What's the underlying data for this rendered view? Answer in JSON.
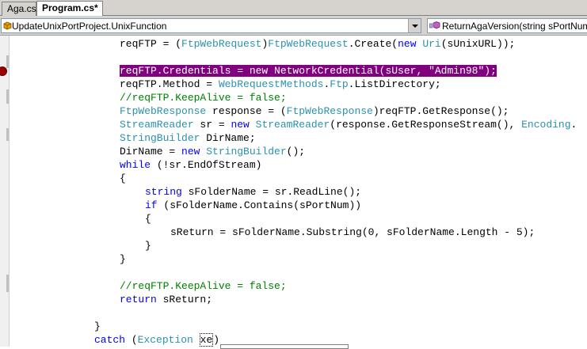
{
  "tabs": [
    "Aga.cs",
    "Program.cs*"
  ],
  "nav": {
    "class_combo": "UpdateUnixPortProject.UnixFunction",
    "member_combo": "ReturnAgaVersion(string sPortNum, st"
  },
  "code": {
    "l1": [
      "reqFTP",
      " = (",
      "FtpWebRequest",
      ")",
      "FtpWebRequest",
      ".Create(",
      "new",
      " ",
      "Uri",
      "(sUnixURL));"
    ],
    "l2": "reqFTP.Credentials = new NetworkCredential(sUser, \"Admin98\");",
    "l3": [
      "reqFTP.Method = ",
      "WebRequestMethods",
      ".",
      "Ftp",
      ".ListDirectory;"
    ],
    "l4": "//reqFTP.KeepAlive = false;",
    "l5": [
      "FtpWebResponse",
      " response = (",
      "FtpWebResponse",
      ")reqFTP.GetResponse();"
    ],
    "l6": [
      "StreamReader",
      " sr = ",
      "new",
      " ",
      "StreamReader",
      "(response.GetResponseStream(), ",
      "Encoding",
      "."
    ],
    "l7": [
      "StringBuilder",
      " DirName;"
    ],
    "l8": [
      "DirName = ",
      "new",
      " ",
      "StringBuilder",
      "();"
    ],
    "l9": [
      "while",
      " (!sr.EndOfStream)"
    ],
    "l10": "{",
    "l11": [
      "string",
      " sFolderName = sr.ReadLine();"
    ],
    "l12": [
      "if",
      " (sFolderName.Contains(sPortNum))"
    ],
    "l13": "{",
    "l14": "sReturn = sFolderName.Substring(0, sFolderName.Length - 5);",
    "l15": "}",
    "l16": "}",
    "l17": "//reqFTP.KeepAlive = false;",
    "l18": [
      "return",
      " sReturn;"
    ],
    "l19": "}",
    "l20": [
      "catch",
      " (",
      "Exception",
      " ",
      "xe",
      ")"
    ]
  }
}
